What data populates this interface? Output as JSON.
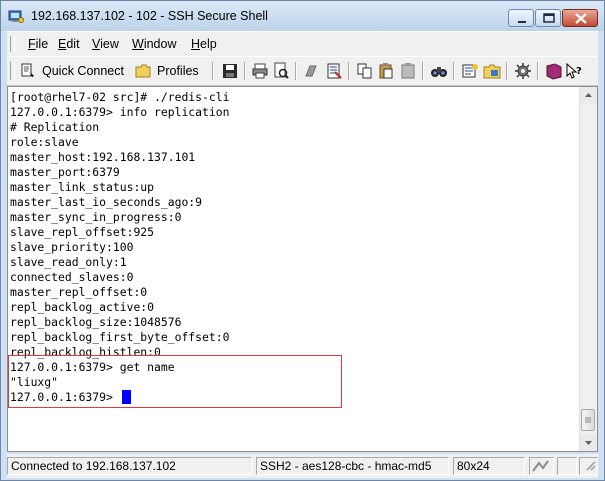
{
  "window": {
    "title": "192.168.137.102 - 102 - SSH Secure Shell"
  },
  "menu": [
    {
      "label": "File",
      "mnemonic": "F",
      "rest": "ile"
    },
    {
      "label": "Edit",
      "mnemonic": "E",
      "rest": "dit"
    },
    {
      "label": "View",
      "mnemonic": "V",
      "rest": "iew"
    },
    {
      "label": "Window",
      "mnemonic": "W",
      "rest": "indow"
    },
    {
      "label": "Help",
      "mnemonic": "H",
      "rest": "elp"
    }
  ],
  "toolbar": {
    "quick_connect": "Quick Connect",
    "profiles": "Profiles"
  },
  "terminal": {
    "lines": [
      "[root@rhel7-02 src]# ./redis-cli",
      "127.0.0.1:6379> info replication",
      "# Replication",
      "role:slave",
      "master_host:192.168.137.101",
      "master_port:6379",
      "master_link_status:up",
      "master_last_io_seconds_ago:9",
      "master_sync_in_progress:0",
      "slave_repl_offset:925",
      "slave_priority:100",
      "slave_read_only:1",
      "connected_slaves:0",
      "master_repl_offset:0",
      "repl_backlog_active:0",
      "repl_backlog_size:1048576",
      "repl_backlog_first_byte_offset:0",
      "repl_backlog_histlen:0",
      "127.0.0.1:6379> get name",
      "\"liuxg\"",
      "127.0.0.1:6379> "
    ]
  },
  "status": {
    "connection": "Connected to 192.168.137.102",
    "cipher": "SSH2 - aes128-cbc - hmac-md5",
    "size": "80x24"
  },
  "colors": {
    "cursor": "#0000ff",
    "highlight": "#e23b3b"
  }
}
